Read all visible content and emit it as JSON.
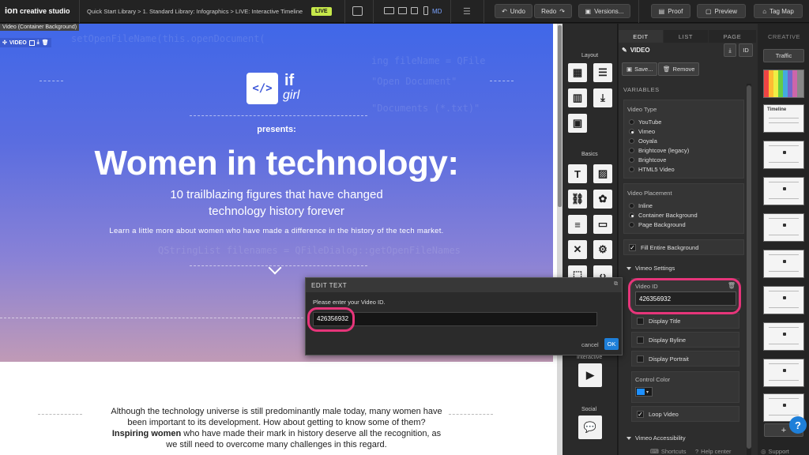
{
  "topbar": {
    "app_name": "creative studio",
    "app_logo": "ion",
    "breadcrumb": "Quick Start Library > 1. Standard Library: Infographics > LIVE: Interactive Timeline",
    "live_badge": "LIVE",
    "device_label": "MD",
    "undo": "Undo",
    "redo": "Redo",
    "versions": "Versions...",
    "proof": "Proof",
    "preview": "Preview",
    "tagmap": "Tag Map"
  },
  "canvas": {
    "container_tag": "Video (Container Background)",
    "video_tag": "VIDEO",
    "logo_code": "</>",
    "logo_if": "if",
    "logo_girl": "girl",
    "presents": "presents:",
    "headline": "Women in technology:",
    "subheadline": "10 trailblazing figures that have changed technology history forever",
    "intro": "Learn a little more about women who have made a difference in the history of the tech market.",
    "body_before": "Although the technology universe is still predominantly male today, many women have been important to its development. How about getting to know some of them? ",
    "body_bold": "Inspiring women",
    "body_after": " who have made their mark in history deserve all the recognition, as we still need to overcome many challenges in this regard."
  },
  "dialog": {
    "title": "EDIT TEXT",
    "prompt": "Please enter your Video ID.",
    "value": "426356932",
    "cancel": "cancel",
    "ok": "OK"
  },
  "components": {
    "layout_label": "Layout",
    "basics_label": "Basics",
    "interactive_label": "Interactive",
    "social_label": "Social"
  },
  "settings": {
    "tabs": [
      "EDIT",
      "LIST",
      "PAGE"
    ],
    "element_title": "VIDEO",
    "id_button": "ID",
    "save": "Save...",
    "remove": "Remove",
    "variables": "VARIABLES",
    "video_type_label": "Video Type",
    "video_types": [
      "YouTube",
      "Vimeo",
      "Ooyala",
      "Brightcove (legacy)",
      "Brightcove",
      "HTML5 Video"
    ],
    "video_type_selected": 1,
    "placement_label": "Video Placement",
    "placements": [
      "Inline",
      "Container Background",
      "Page Background"
    ],
    "placement_selected": 1,
    "fill_background": "Fill Entire Background",
    "vimeo_settings": "Vimeo Settings",
    "video_id_label": "Video ID",
    "video_id_value": "426356932",
    "display_title": "Display Title",
    "display_byline": "Display Byline",
    "display_portrait": "Display Portrait",
    "control_color_label": "Control Color",
    "control_color": "#1e90ff",
    "loop_video": "Loop Video",
    "vimeo_accessibility": "Vimeo Accessibility",
    "footer_shortcuts": "Shortcuts",
    "footer_help": "Help center",
    "footer_support": "Support"
  },
  "creative": {
    "header": "CREATIVE",
    "traffic_button": "Traffic",
    "thumb_label": "Timeline",
    "add_button": "+",
    "help_button": "?"
  },
  "colors": {
    "accent": "#e6357a",
    "live": "#c6e84a",
    "ok_blue": "#1e7fd9",
    "hero_top": "#4067e8",
    "hero_bottom": "#c09ab6"
  }
}
